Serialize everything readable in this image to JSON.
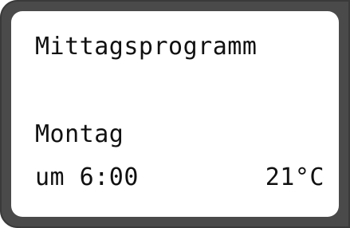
{
  "display": {
    "program_title": "Mittagsprogramm",
    "day": "Montag",
    "time": "um 6:00",
    "temperature": "21°C"
  }
}
